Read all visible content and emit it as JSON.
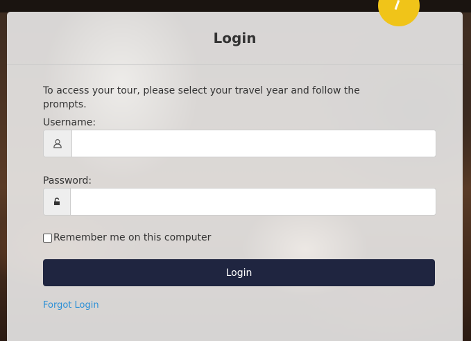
{
  "login_panel": {
    "title": "Login",
    "intro_text": "To access your tour, please select your travel year and follow the prompts.",
    "username": {
      "label": "Username:",
      "value": "",
      "placeholder": "",
      "icon": "user-icon"
    },
    "password": {
      "label": "Password:",
      "value": "",
      "placeholder": "",
      "icon": "unlocked-padlock-icon"
    },
    "remember_me_label": "Remember me on this computer",
    "remember_me_checked": false,
    "login_button_label": "Login",
    "forgot_login_label": "Forgot Login"
  },
  "colors": {
    "button_bg": "#1f2540",
    "link": "#2a8fd6",
    "badge": "#f0c419"
  }
}
